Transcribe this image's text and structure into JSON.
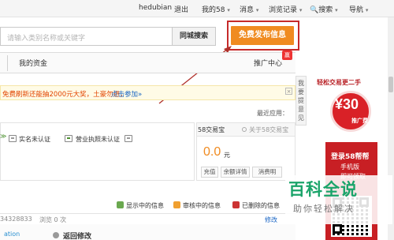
{
  "topbar": {
    "username": "hedubian",
    "logout": "退出",
    "my58": "我的58",
    "messages": "消息",
    "history": "浏览记录",
    "search": "搜索",
    "nav": "导航",
    "caret": "▾"
  },
  "search": {
    "placeholder": "请输入类别名称或关键字",
    "button": "同城搜索"
  },
  "publish_button": "免费发布信息",
  "tabs": {
    "assets": "我的资金",
    "promotion": "推广中心",
    "badge": "赢"
  },
  "notice": {
    "text": "免费刷新还能抽2000元大奖，土豪勿进，",
    "link": "点击参加»",
    "close": "×"
  },
  "recent_apps": "最近应用：",
  "verification": {
    "realname": "实名未认证",
    "license": "营业执照未认证",
    "left_marker": "≫"
  },
  "treasure": {
    "tab_active": "58交易宝",
    "tab_about": "关于58交易宝",
    "amount": "0.0",
    "unit": "元",
    "btn_recharge": "充值",
    "btn_detail": "余额详情",
    "btn_consume": "消费明"
  },
  "info_status": {
    "showing": "显示中的信息",
    "reviewing": "审核中的信息",
    "deleted": "已删除的信息"
  },
  "row": {
    "id_fragment": "34328833",
    "views": "浏览 0 次",
    "edit": "修改",
    "action": "返回修改",
    "status_icon": "ation"
  },
  "right_tab": [
    "我",
    "要",
    "提",
    "意",
    "见"
  ],
  "ad": {
    "arc": "轻松交易更二手",
    "amount": "¥30",
    "card": "推广费",
    "line1": "登录58帮帮",
    "line2": "手机版",
    "line3": "即可领取"
  },
  "watermark": {
    "title": "百科全说",
    "subtitle": "助你轻松解决"
  },
  "colors": {
    "accent": "#f08b21",
    "highlight_box": "#c62a2a",
    "link": "#1a66c4",
    "ad_red": "#c81f24",
    "watermark_green": "#1aa46a"
  }
}
